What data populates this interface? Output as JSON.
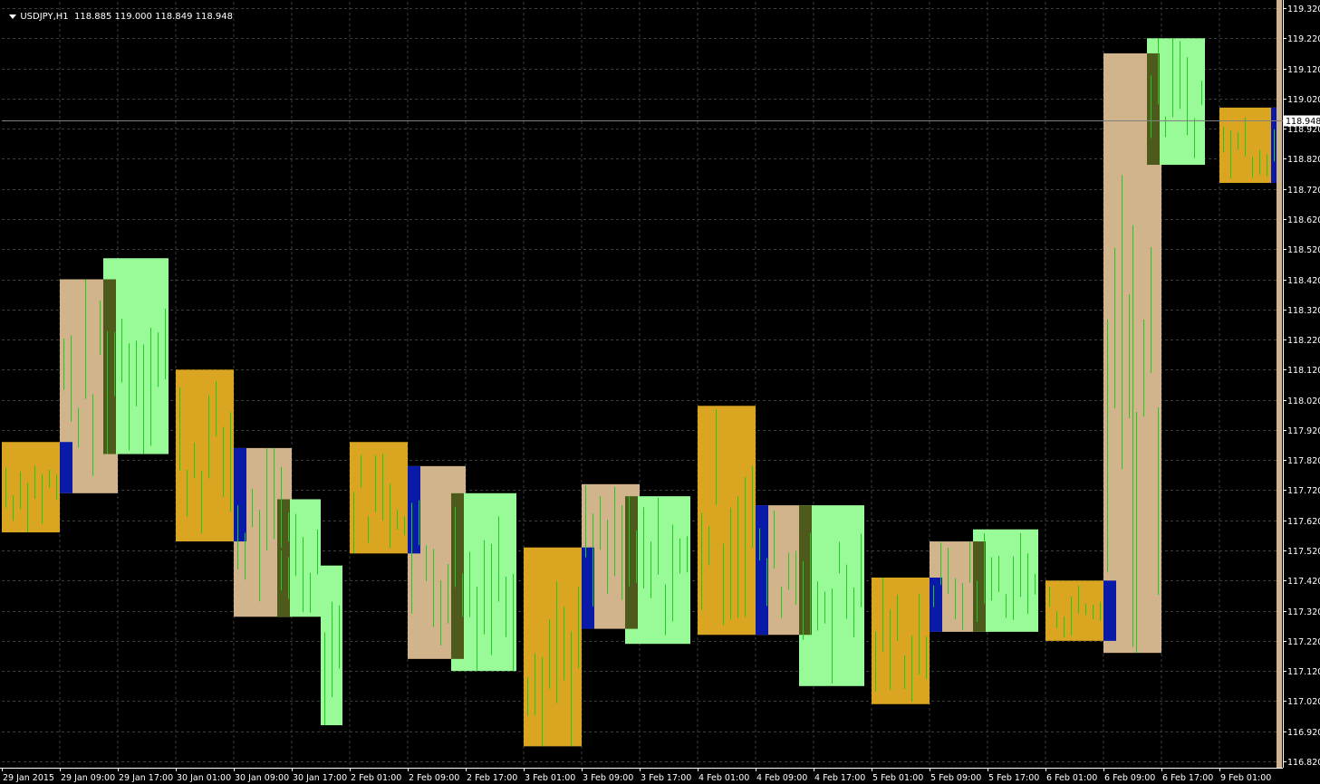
{
  "header": {
    "symbol": "USDJPY,H1",
    "ohlc": "118.885 119.000 118.849 118.948"
  },
  "colors": {
    "background": "#000000",
    "grid": "#3d3d3d",
    "axis": "#ffffff",
    "text": "#ffffff",
    "candle_wick": "#22c922",
    "asia_box": "#daa520",
    "europe_box": "#d2b48c",
    "us_box": "#98fb98",
    "asia_bar": "#0a1aa8",
    "europe_bar": "#4e5a1c",
    "bid_line": "#808080",
    "price_tag_bg": "#ffffff",
    "price_tag_text": "#000000",
    "right_strip": "#d2b48c"
  },
  "chart_data": {
    "type": "bar",
    "title": "USDJPY,H1",
    "y_axis": {
      "ylim": [
        116.78,
        119.33
      ],
      "ticks": [
        "119.320",
        "119.220",
        "119.120",
        "119.020",
        "118.920",
        "118.820",
        "118.720",
        "118.620",
        "118.520",
        "118.420",
        "118.320",
        "118.220",
        "118.120",
        "118.020",
        "117.920",
        "117.820",
        "117.720",
        "117.620",
        "117.520",
        "117.420",
        "117.320",
        "117.220",
        "117.120",
        "117.020",
        "116.920",
        "116.820"
      ]
    },
    "x_axis": {
      "ticks": [
        "29 Jan 2015",
        "29 Jan 09:00",
        "29 Jan 17:00",
        "30 Jan 01:00",
        "30 Jan 09:00",
        "30 Jan 17:00",
        "2 Feb 01:00",
        "2 Feb 09:00",
        "2 Feb 17:00",
        "3 Feb 01:00",
        "3 Feb 09:00",
        "3 Feb 17:00",
        "4 Feb 01:00",
        "4 Feb 09:00",
        "4 Feb 17:00",
        "5 Feb 01:00",
        "5 Feb 09:00",
        "5 Feb 17:00",
        "6 Feb 01:00",
        "6 Feb 09:00",
        "6 Feb 17:00",
        "9 Feb 01:00"
      ]
    },
    "bid_price": "118.948",
    "sessions": [
      {
        "session": "asia",
        "start": "29 Jan 2015 00:00",
        "end": "29 Jan 08:00",
        "high": 117.88,
        "low": 117.58
      },
      {
        "session": "europe",
        "start": "29 Jan 08:00",
        "end": "29 Jan 16:00",
        "high": 118.42,
        "low": 117.71
      },
      {
        "session": "us",
        "start": "29 Jan 14:00",
        "end": "29 Jan 23:00",
        "high": 118.49,
        "low": 117.84
      },
      {
        "session": "asia",
        "start": "30 Jan 00:00",
        "end": "30 Jan 08:00",
        "high": 118.12,
        "low": 117.55
      },
      {
        "session": "europe",
        "start": "30 Jan 08:00",
        "end": "30 Jan 16:00",
        "high": 117.86,
        "low": 117.3
      },
      {
        "session": "us",
        "start": "30 Jan 14:00",
        "end": "30 Jan 20:00",
        "high": 117.69,
        "low": 117.3
      },
      {
        "session": "us-tail",
        "start": "30 Jan 20:00",
        "end": "30 Jan 23:00",
        "high": 117.47,
        "low": 116.94
      },
      {
        "session": "asia",
        "start": "2 Feb 00:00",
        "end": "2 Feb 08:00",
        "high": 117.88,
        "low": 117.51
      },
      {
        "session": "europe",
        "start": "2 Feb 08:00",
        "end": "2 Feb 16:00",
        "high": 117.8,
        "low": 117.16
      },
      {
        "session": "us",
        "start": "2 Feb 14:00",
        "end": "2 Feb 23:00",
        "high": 117.71,
        "low": 117.12
      },
      {
        "session": "asia",
        "start": "3 Feb 00:00",
        "end": "3 Feb 08:00",
        "high": 117.53,
        "low": 116.87
      },
      {
        "session": "europe",
        "start": "3 Feb 08:00",
        "end": "3 Feb 16:00",
        "high": 117.74,
        "low": 117.26
      },
      {
        "session": "us",
        "start": "3 Feb 14:00",
        "end": "3 Feb 23:00",
        "high": 117.7,
        "low": 117.21
      },
      {
        "session": "asia",
        "start": "4 Feb 00:00",
        "end": "4 Feb 08:00",
        "high": 118.0,
        "low": 117.24
      },
      {
        "session": "europe",
        "start": "4 Feb 08:00",
        "end": "4 Feb 16:00",
        "high": 117.67,
        "low": 117.24
      },
      {
        "session": "us",
        "start": "4 Feb 14:00",
        "end": "4 Feb 23:00",
        "high": 117.67,
        "low": 117.07
      },
      {
        "session": "asia",
        "start": "5 Feb 00:00",
        "end": "5 Feb 08:00",
        "high": 117.43,
        "low": 117.01
      },
      {
        "session": "europe",
        "start": "5 Feb 08:00",
        "end": "5 Feb 16:00",
        "high": 117.55,
        "low": 117.25
      },
      {
        "session": "us",
        "start": "5 Feb 14:00",
        "end": "5 Feb 23:00",
        "high": 117.59,
        "low": 117.25
      },
      {
        "session": "asia",
        "start": "6 Feb 00:00",
        "end": "6 Feb 08:00",
        "high": 117.42,
        "low": 117.22
      },
      {
        "session": "europe",
        "start": "6 Feb 08:00",
        "end": "6 Feb 16:00",
        "high": 119.17,
        "low": 117.18
      },
      {
        "session": "us",
        "start": "6 Feb 14:00",
        "end": "6 Feb 22:00",
        "high": 119.22,
        "low": 118.8
      },
      {
        "session": "asia",
        "start": "9 Feb 00:00",
        "end": "9 Feb 08:00",
        "high": 118.99,
        "low": 118.74
      }
    ]
  }
}
